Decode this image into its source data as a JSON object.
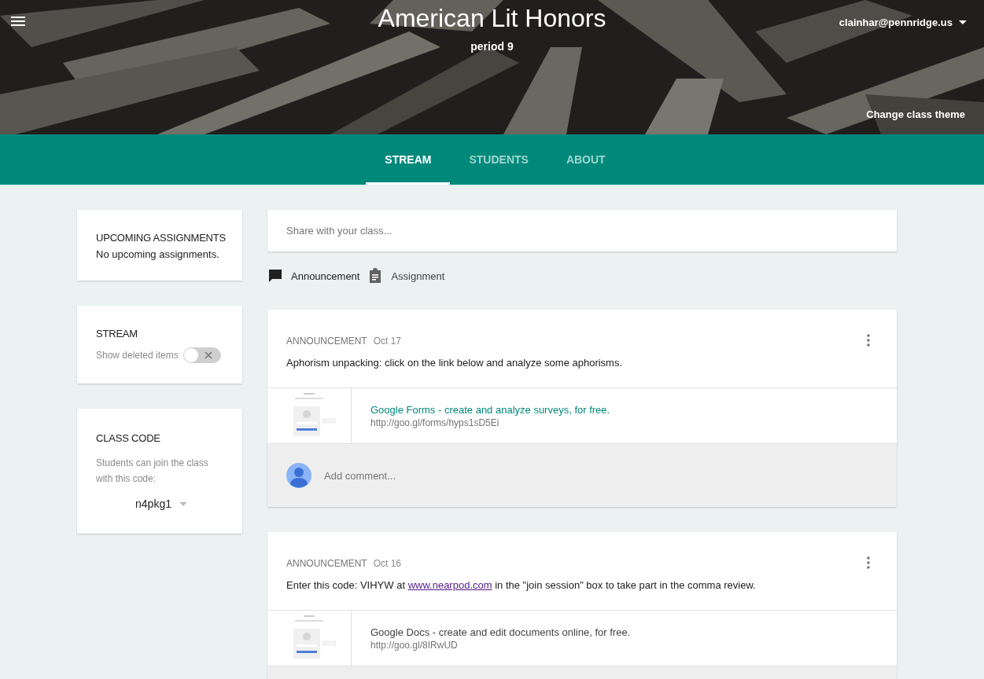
{
  "header": {
    "title": "American Lit Honors",
    "subtitle": "period 9",
    "account": "clainhar@pennridge.us",
    "theme_link": "Change class theme"
  },
  "tabs": [
    {
      "label": "STREAM",
      "selected": true
    },
    {
      "label": "STUDENTS",
      "selected": false
    },
    {
      "label": "ABOUT",
      "selected": false
    }
  ],
  "upcoming": {
    "title": "UPCOMING ASSIGNMENTS",
    "text": "No upcoming assignments."
  },
  "stream_card": {
    "title": "STREAM",
    "toggle_label": "Show deleted items",
    "on": false
  },
  "class_code": {
    "title": "CLASS CODE",
    "text": "Students can join the class with this code:",
    "code": "n4pkg1"
  },
  "share": {
    "placeholder": "Share with your class...",
    "options": [
      {
        "label": "Announcement",
        "kind": "announcement",
        "selected": true
      },
      {
        "label": "Assignment",
        "kind": "assignment",
        "selected": false
      }
    ]
  },
  "posts": [
    {
      "type": "ANNOUNCEMENT",
      "date": "Oct 17",
      "parts": [
        {
          "kind": "text",
          "text": "Aphorism unpacking: click on the link below and analyze some aphorisms."
        }
      ],
      "attachment": {
        "title": "Google Forms - create and analyze surveys, for free.",
        "url": "http://goo.gl/forms/hyps1sD5Ei",
        "highlighted": true
      },
      "comment_placeholder": "Add comment..."
    },
    {
      "type": "ANNOUNCEMENT",
      "date": "Oct 16",
      "parts": [
        {
          "kind": "text",
          "text": "Enter this code: VIHYW at "
        },
        {
          "kind": "link",
          "text": "www.nearpod.com"
        },
        {
          "kind": "text",
          "text": " in the \"join session\" box to take part in the comma review."
        }
      ],
      "attachment": {
        "title": "Google Docs - create and edit documents online, for free.",
        "url": "http://goo.gl/8IRwUD",
        "highlighted": false
      }
    }
  ]
}
